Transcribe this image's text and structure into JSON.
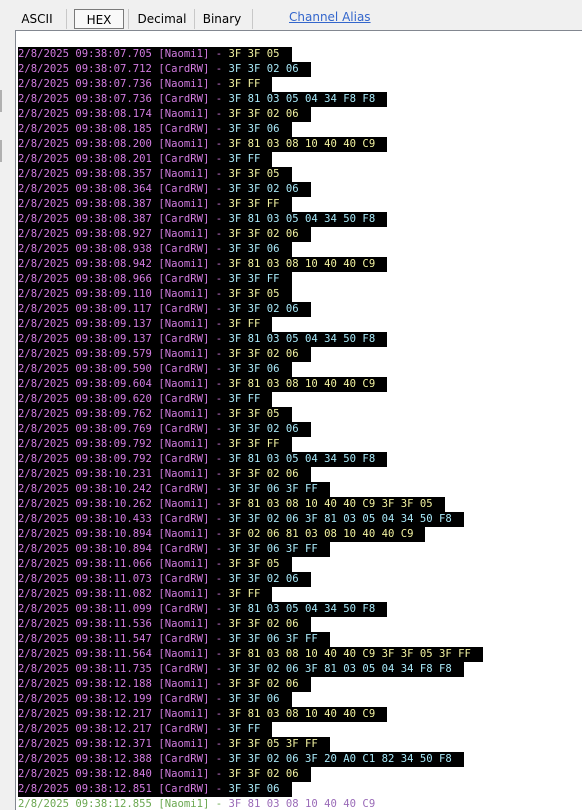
{
  "tabs": [
    {
      "label": "ASCII",
      "active": false
    },
    {
      "label": "HEX",
      "active": true
    },
    {
      "label": "Decimal",
      "active": false
    },
    {
      "label": "Binary",
      "active": false
    }
  ],
  "channel_alias_link": "Channel Alias",
  "colors": {
    "timestamp": "#d27be0",
    "naomi_payload": "#f2f2a0",
    "card_payload": "#a8e8f8",
    "line_background": "#000000",
    "link": "#3366cc"
  },
  "log": [
    {
      "ts": "2/8/2025 09:38:07.705",
      "device": "[Naomi1]",
      "data": "3F 3F 05"
    },
    {
      "ts": "2/8/2025 09:38:07.712",
      "device": "[CardRW]",
      "data": "3F 3F 02 06"
    },
    {
      "ts": "2/8/2025 09:38:07.736",
      "device": "[Naomi1]",
      "data": "3F FF"
    },
    {
      "ts": "2/8/2025 09:38:07.736",
      "device": "[CardRW]",
      "data": "3F 81 03 05 04 34 F8 F8"
    },
    {
      "ts": "2/8/2025 09:38:08.174",
      "device": "[Naomi1]",
      "data": "3F 3F 02 06"
    },
    {
      "ts": "2/8/2025 09:38:08.185",
      "device": "[CardRW]",
      "data": "3F 3F 06"
    },
    {
      "ts": "2/8/2025 09:38:08.200",
      "device": "[Naomi1]",
      "data": "3F 81 03 08 10 40 40 C9"
    },
    {
      "ts": "2/8/2025 09:38:08.201",
      "device": "[CardRW]",
      "data": "3F FF"
    },
    {
      "ts": "2/8/2025 09:38:08.357",
      "device": "[Naomi1]",
      "data": "3F 3F 05"
    },
    {
      "ts": "2/8/2025 09:38:08.364",
      "device": "[CardRW]",
      "data": "3F 3F 02 06"
    },
    {
      "ts": "2/8/2025 09:38:08.387",
      "device": "[Naomi1]",
      "data": "3F 3F FF"
    },
    {
      "ts": "2/8/2025 09:38:08.387",
      "device": "[CardRW]",
      "data": "3F 81 03 05 04 34 50 F8"
    },
    {
      "ts": "2/8/2025 09:38:08.927",
      "device": "[Naomi1]",
      "data": "3F 3F 02 06"
    },
    {
      "ts": "2/8/2025 09:38:08.938",
      "device": "[CardRW]",
      "data": "3F 3F 06"
    },
    {
      "ts": "2/8/2025 09:38:08.942",
      "device": "[Naomi1]",
      "data": "3F 81 03 08 10 40 40 C9"
    },
    {
      "ts": "2/8/2025 09:38:08.966",
      "device": "[CardRW]",
      "data": "3F 3F FF"
    },
    {
      "ts": "2/8/2025 09:38:09.110",
      "device": "[Naomi1]",
      "data": "3F 3F 05"
    },
    {
      "ts": "2/8/2025 09:38:09.117",
      "device": "[CardRW]",
      "data": "3F 3F 02 06"
    },
    {
      "ts": "2/8/2025 09:38:09.137",
      "device": "[Naomi1]",
      "data": "3F FF"
    },
    {
      "ts": "2/8/2025 09:38:09.137",
      "device": "[CardRW]",
      "data": "3F 81 03 05 04 34 50 F8"
    },
    {
      "ts": "2/8/2025 09:38:09.579",
      "device": "[Naomi1]",
      "data": "3F 3F 02 06"
    },
    {
      "ts": "2/8/2025 09:38:09.590",
      "device": "[CardRW]",
      "data": "3F 3F 06"
    },
    {
      "ts": "2/8/2025 09:38:09.604",
      "device": "[Naomi1]",
      "data": "3F 81 03 08 10 40 40 C9"
    },
    {
      "ts": "2/8/2025 09:38:09.620",
      "device": "[CardRW]",
      "data": "3F FF"
    },
    {
      "ts": "2/8/2025 09:38:09.762",
      "device": "[Naomi1]",
      "data": "3F 3F 05"
    },
    {
      "ts": "2/8/2025 09:38:09.769",
      "device": "[CardRW]",
      "data": "3F 3F 02 06"
    },
    {
      "ts": "2/8/2025 09:38:09.792",
      "device": "[Naomi1]",
      "data": "3F 3F FF"
    },
    {
      "ts": "2/8/2025 09:38:09.792",
      "device": "[CardRW]",
      "data": "3F 81 03 05 04 34 50 F8"
    },
    {
      "ts": "2/8/2025 09:38:10.231",
      "device": "[Naomi1]",
      "data": "3F 3F 02 06"
    },
    {
      "ts": "2/8/2025 09:38:10.242",
      "device": "[CardRW]",
      "data": "3F 3F 06 3F FF"
    },
    {
      "ts": "2/8/2025 09:38:10.262",
      "device": "[Naomi1]",
      "data": "3F 81 03 08 10 40 40 C9 3F 3F 05"
    },
    {
      "ts": "2/8/2025 09:38:10.433",
      "device": "[CardRW]",
      "data": "3F 3F 02 06 3F 81 03 05 04 34 50 F8"
    },
    {
      "ts": "2/8/2025 09:38:10.894",
      "device": "[Naomi1]",
      "data": "3F 02 06 81 03 08 10 40 40 C9"
    },
    {
      "ts": "2/8/2025 09:38:10.894",
      "device": "[CardRW]",
      "data": "3F 3F 06 3F FF"
    },
    {
      "ts": "2/8/2025 09:38:11.066",
      "device": "[Naomi1]",
      "data": "3F 3F 05"
    },
    {
      "ts": "2/8/2025 09:38:11.073",
      "device": "[CardRW]",
      "data": "3F 3F 02 06"
    },
    {
      "ts": "2/8/2025 09:38:11.082",
      "device": "[Naomi1]",
      "data": "3F FF"
    },
    {
      "ts": "2/8/2025 09:38:11.099",
      "device": "[CardRW]",
      "data": "3F 81 03 05 04 34 50 F8"
    },
    {
      "ts": "2/8/2025 09:38:11.536",
      "device": "[Naomi1]",
      "data": "3F 3F 02 06"
    },
    {
      "ts": "2/8/2025 09:38:11.547",
      "device": "[CardRW]",
      "data": "3F 3F 06 3F FF"
    },
    {
      "ts": "2/8/2025 09:38:11.564",
      "device": "[Naomi1]",
      "data": "3F 81 03 08 10 40 40 C9 3F 3F 05 3F FF"
    },
    {
      "ts": "2/8/2025 09:38:11.735",
      "device": "[CardRW]",
      "data": "3F 3F 02 06 3F 81 03 05 04 34 F8 F8"
    },
    {
      "ts": "2/8/2025 09:38:12.188",
      "device": "[Naomi1]",
      "data": "3F 3F 02 06"
    },
    {
      "ts": "2/8/2025 09:38:12.199",
      "device": "[CardRW]",
      "data": "3F 3F 06"
    },
    {
      "ts": "2/8/2025 09:38:12.217",
      "device": "[Naomi1]",
      "data": "3F 81 03 08 10 40 40 C9"
    },
    {
      "ts": "2/8/2025 09:38:12.217",
      "device": "[CardRW]",
      "data": "3F FF"
    },
    {
      "ts": "2/8/2025 09:38:12.371",
      "device": "[Naomi1]",
      "data": "3F 3F 05 3F FF"
    },
    {
      "ts": "2/8/2025 09:38:12.388",
      "device": "[CardRW]",
      "data": "3F 3F 02 06 3F 20 A0 C1 82 34 50 F8"
    },
    {
      "ts": "2/8/2025 09:38:12.840",
      "device": "[Naomi1]",
      "data": "3F 3F 02 06"
    },
    {
      "ts": "2/8/2025 09:38:12.851",
      "device": "[CardRW]",
      "data": "3F 3F 06"
    },
    {
      "ts": "2/8/2025 09:38:12.855",
      "device": "[Naomi1]",
      "data": "3F 81 03 08 10 40 40 C9"
    }
  ]
}
